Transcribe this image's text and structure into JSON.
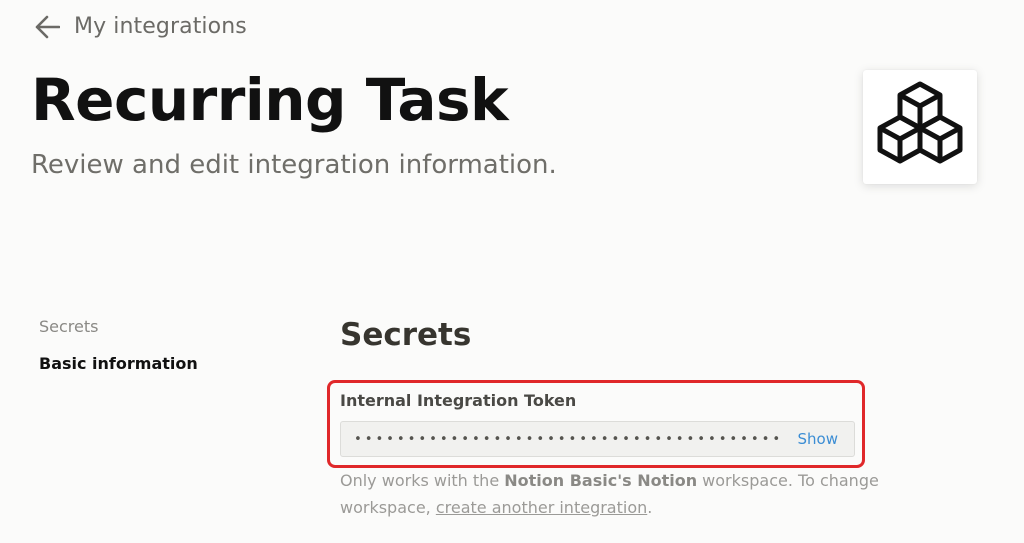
{
  "back_link": {
    "label": "My integrations",
    "icon": "arrow-left-icon"
  },
  "header": {
    "title": "Recurring Task",
    "subtitle": "Review and edit integration information.",
    "logo_icon": "cubes-icon"
  },
  "sidebar": {
    "items": [
      {
        "label": "Secrets",
        "active": false
      },
      {
        "label": "Basic information",
        "active": true
      }
    ]
  },
  "secrets": {
    "section_title": "Secrets",
    "token_label": "Internal Integration Token",
    "token_mask": "••••••••••••••••••••••••••••••••••••••••",
    "show_label": "Show",
    "help_prefix": "Only works with the ",
    "workspace_name": "Notion Basic's Notion",
    "help_middle": " workspace. To change workspace, ",
    "help_link": "create another integration",
    "help_suffix": "."
  },
  "colors": {
    "highlight": "#e0282a",
    "link": "#3b8dd4",
    "background": "#fbfbfa"
  }
}
